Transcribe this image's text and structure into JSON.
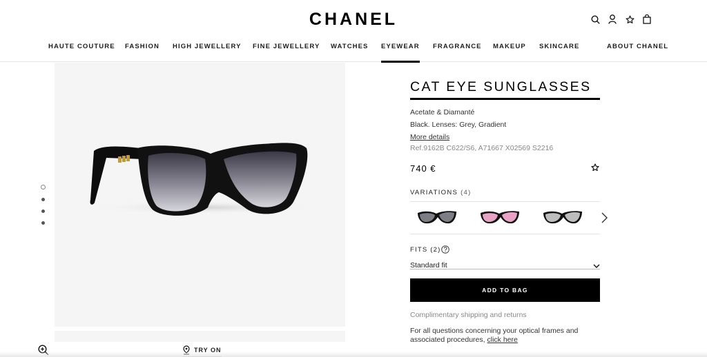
{
  "header": {
    "logo": "CHANEL",
    "icons": [
      "search-icon",
      "account-icon",
      "wishlist-icon",
      "bag-icon"
    ]
  },
  "nav": {
    "items": [
      {
        "label": "HAUTE COUTURE"
      },
      {
        "label": "FASHION"
      },
      {
        "label": "HIGH JEWELLERY"
      },
      {
        "label": "FINE JEWELLERY"
      },
      {
        "label": "WATCHES"
      },
      {
        "label": "EYEWEAR",
        "active": true
      },
      {
        "label": "FRAGRANCE"
      },
      {
        "label": "MAKEUP"
      },
      {
        "label": "SKINCARE"
      },
      {
        "label": "ABOUT CHANEL"
      }
    ]
  },
  "gallery": {
    "icons": [
      "glasses-image",
      "zoom-icon",
      "pin-icon"
    ],
    "slide_count": 4,
    "active_slide": 1,
    "try_on_label": "TRY ON"
  },
  "product": {
    "title": "CAT EYE SUNGLASSES",
    "material": "Acetate & Diamanté",
    "colour": "Black. Lenses: Grey, Gradient",
    "more_details": "More details",
    "ref": "Ref.9162B C622/S6, A71667 X02569 S2216",
    "price": "740 €",
    "variations_label": "VARIATIONS",
    "variations_count": "(4)",
    "variation_lens_colors": [
      "#7d7d85",
      "#e7a2c6",
      "#bdbdbd"
    ],
    "fits_label": "FITS (2)",
    "fit_selected": "Standard fit",
    "add_to_bag": "ADD TO BAG",
    "shipping": "Complimentary shipping and returns",
    "questions_text": "For all questions concerning your optical frames and associated procedures,",
    "click_here": "click here"
  }
}
